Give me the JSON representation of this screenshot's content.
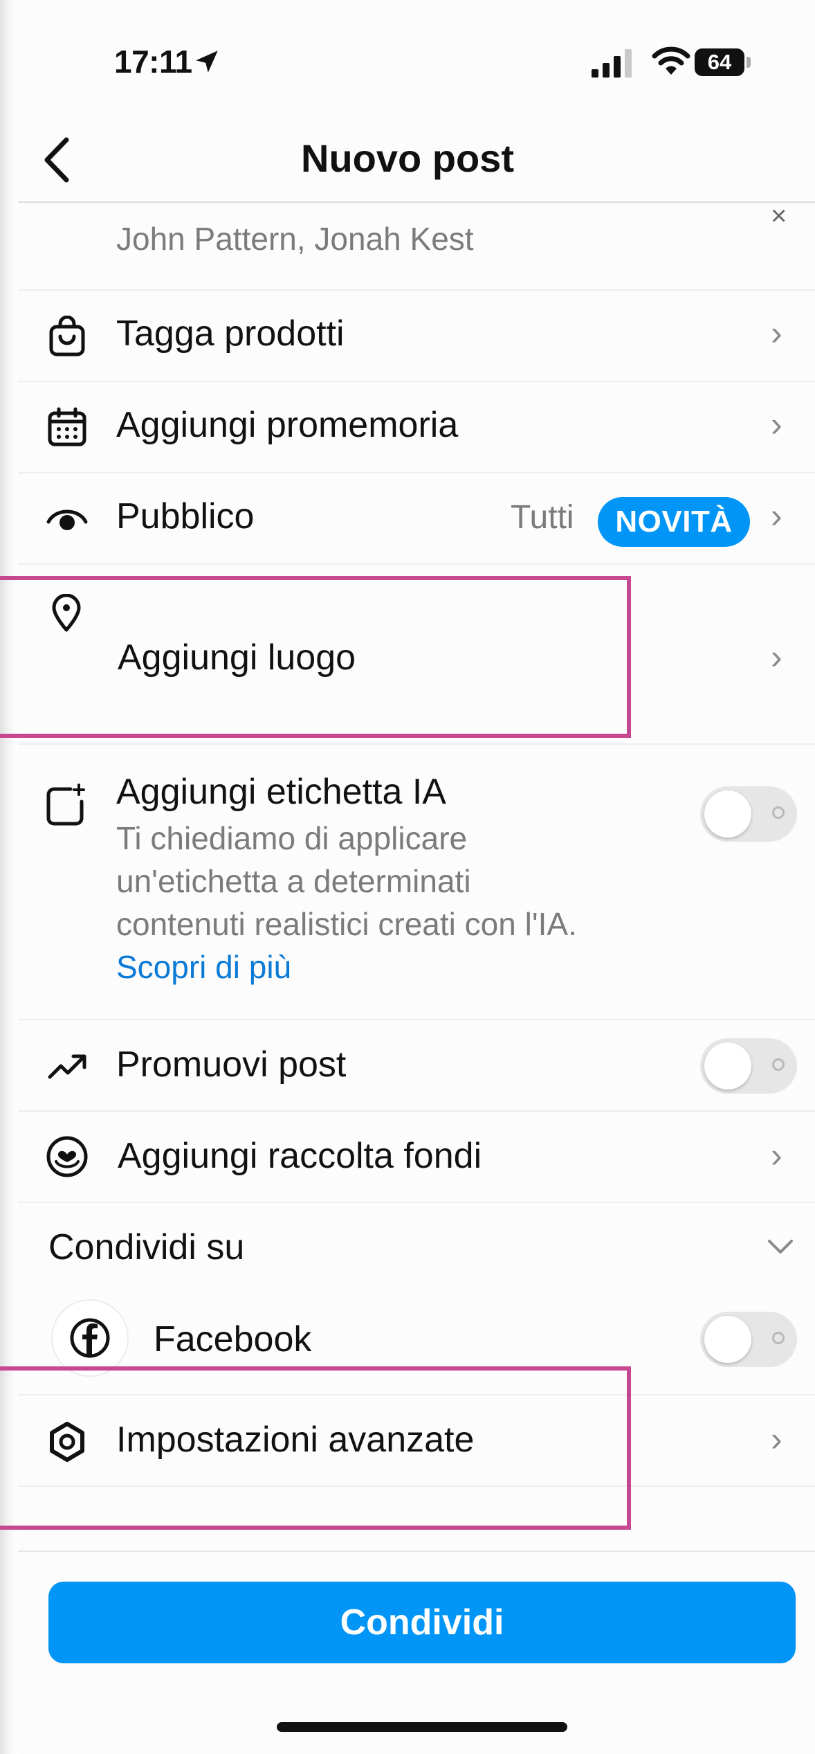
{
  "status_bar": {
    "time": "17:11",
    "battery": "64"
  },
  "header": {
    "title": "Nuovo post"
  },
  "tagged_people": {
    "names": "John Pattern, Jonah Kest",
    "remove_symbol": "×"
  },
  "rows": {
    "tag_products": {
      "label": "Tagga prodotti"
    },
    "add_reminder": {
      "label": "Aggiungi promemoria"
    },
    "audience": {
      "label": "Pubblico",
      "value": "Tutti",
      "badge": "NOVITÀ"
    },
    "add_location": {
      "label": "Aggiungi luogo"
    },
    "ai_label": {
      "label": "Aggiungi etichetta IA",
      "description_lines": [
        "Ti chiediamo di applicare",
        "un'etichetta a determinati",
        "contenuti realistici creati con l'IA."
      ],
      "learn_more": "Scopri di più",
      "enabled": false
    },
    "promote_post": {
      "label": "Promuovi post",
      "enabled": false
    },
    "fundraiser": {
      "label": "Aggiungi raccolta fondi"
    },
    "share_on": {
      "label": "Condividi su"
    },
    "facebook": {
      "label": "Facebook",
      "enabled": false
    },
    "advanced_settings": {
      "label": "Impostazioni avanzate"
    }
  },
  "footer": {
    "share_button": "Condividi"
  },
  "colors": {
    "accent": "#0095f6",
    "highlight": "#c64891",
    "secondary_text": "#7b7b7b",
    "link": "#0a7ad6"
  },
  "icons": {
    "tag_products": "shopping-bag-icon",
    "add_reminder": "calendar-icon",
    "audience": "eye-icon",
    "add_location": "location-pin-icon",
    "ai_label": "ai-label-icon",
    "promote_post": "trending-up-icon",
    "fundraiser": "heart-circle-icon",
    "facebook": "facebook-icon",
    "advanced_settings": "gear-icon"
  }
}
